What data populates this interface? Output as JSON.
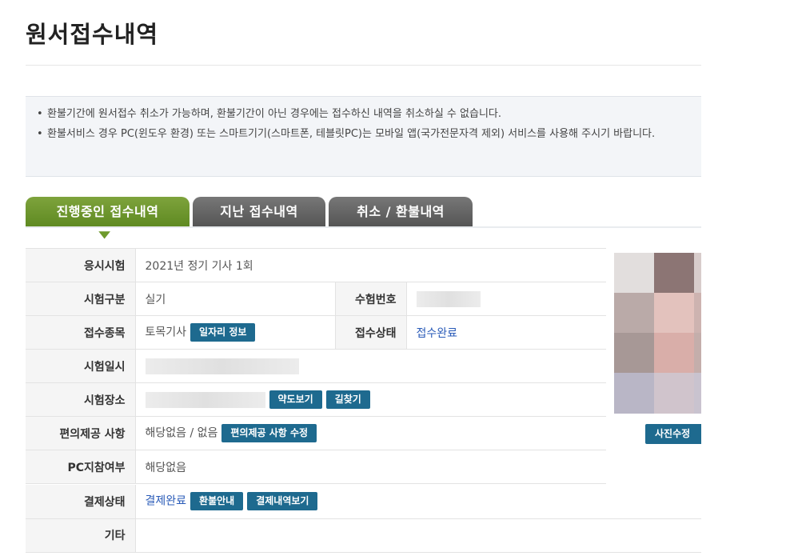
{
  "page": {
    "title": "원서접수내역"
  },
  "notice": {
    "items": [
      "환불기간에 원서접수 취소가 가능하며, 환불기간이 아닌 경우에는 접수하신 내역을 취소하실 수 없습니다.",
      "환불서비스 경우 PC(윈도우 환경) 또는 스마트기기(스마트폰, 테블릿PC)는 모바일 앱(국가전문자격 제외) 서비스를 사용해 주시기 바랍니다."
    ]
  },
  "tabs": [
    {
      "label": "진행중인 접수내역",
      "active": true
    },
    {
      "label": "지난 접수내역",
      "active": false
    },
    {
      "label": "취소 / 환불내역",
      "active": false
    }
  ],
  "details": {
    "exam": {
      "label": "응시시험",
      "value": "2021년 정기 기사 1회"
    },
    "category": {
      "label": "시험구분",
      "value": "실기"
    },
    "exam_number": {
      "label": "수험번호"
    },
    "field": {
      "label": "접수종목",
      "value": "토목기사",
      "button": "일자리 정보"
    },
    "status": {
      "label": "접수상태",
      "value": "접수완료"
    },
    "date": {
      "label": "시험일시"
    },
    "place": {
      "label": "시험장소",
      "buttons": [
        "약도보기",
        "길찾기"
      ]
    },
    "accommodation": {
      "label": "편의제공 사항",
      "value": "해당없음 / 없음",
      "button": "편의제공 사항 수정"
    },
    "pc": {
      "label": "PC지참여부",
      "value": "해당없음"
    },
    "payment": {
      "label": "결제상태",
      "value": "결제완료",
      "buttons": [
        "환불안내",
        "결제내역보기"
      ]
    },
    "etc": {
      "label": "기타",
      "value": ""
    }
  },
  "photo": {
    "edit_button": "사진수정",
    "tiles": [
      "#e2dedd",
      "#8c7574",
      "#d8cccb",
      "#baaaa8",
      "#e3c2bd",
      "#cdb3b0",
      "#a79896",
      "#d9aea9",
      "#c4aeab",
      "#b9b6c6",
      "#d0c4cc",
      "#c9c3cf"
    ]
  }
}
